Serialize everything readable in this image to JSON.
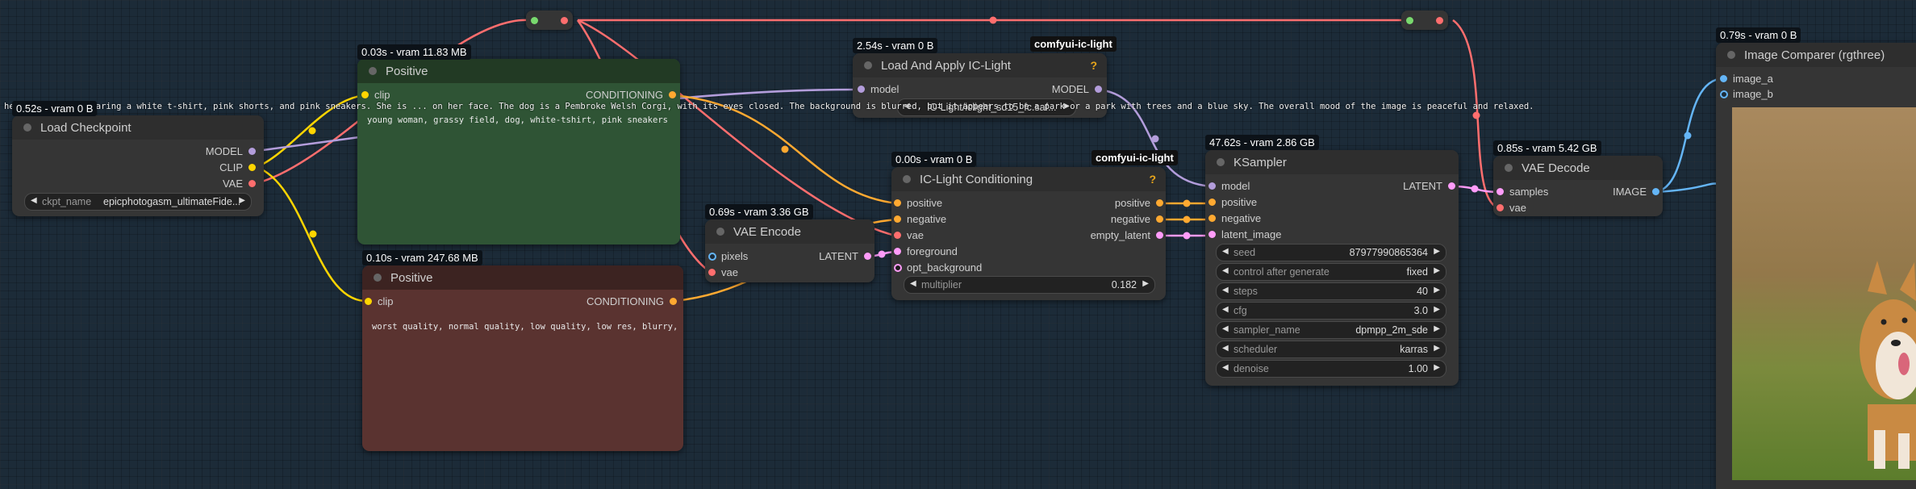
{
  "canvas": {
    "overlay_text": "her (Ok 0-s) is wearing a white t-shirt, pink shorts, and pink sneakers. She is ... on her face. The dog is a Pembroke Welsh Corgi, with its eyes closed. The background is blurred, but it appears to be a park or a park with trees and a blue sky. The overall mood of the image is peaceful and relaxed."
  },
  "colors": {
    "model": "#b39ddb",
    "clip": "#ffd500",
    "vae": "#ff6e6e",
    "conditioning": "#ffa931",
    "latent": "#ff9cf9",
    "image": "#64b5f6",
    "positive_node": "#2f5435",
    "negative_node": "#5a3330",
    "accent_warning": "#e8a61b"
  },
  "nodes": {
    "load_checkpoint": {
      "timing": "0.52s - vram 0 B",
      "title": "Load Checkpoint",
      "outputs": [
        "MODEL",
        "CLIP",
        "VAE"
      ],
      "widget": {
        "name": "ckpt_name",
        "value": "epicphotogasm_ultimateFide..."
      }
    },
    "positive": {
      "timing": "0.03s - vram 11.83 MB",
      "title": "Positive",
      "input": "clip",
      "output": "CONDITIONING",
      "text": "young woman, grassy field, dog, white-tshirt, pink sneakers"
    },
    "negative": {
      "timing": "0.10s - vram 247.68 MB",
      "title": "Positive",
      "input": "clip",
      "output": "CONDITIONING",
      "text": "worst quality, normal quality, low quality, low res, blurry, text, watermark, logo, banner, extra digits, cropped, jpeg artifacts, signature, username, error, sketch, duplicate, ugly, monochrome"
    },
    "load_apply_ic_light": {
      "timing": "2.54s - vram 0 B",
      "badge": "comfyui-ic-light",
      "warning": "?",
      "title": "Load And Apply IC-Light",
      "input": "model",
      "output": "MODEL",
      "widget": {
        "name": "model_path",
        "value": "IC-Light/iclight_sd15_fc.saf..."
      }
    },
    "ic_light_conditioning": {
      "timing": "0.00s - vram 0 B",
      "badge": "comfyui-ic-light",
      "warning": "?",
      "title": "IC-Light Conditioning",
      "inputs": [
        "positive",
        "negative",
        "vae",
        "foreground",
        "opt_background"
      ],
      "outputs": [
        "positive",
        "negative",
        "empty_latent"
      ],
      "widget": {
        "name": "multiplier",
        "value": "0.182"
      }
    },
    "vae_encode": {
      "timing": "0.69s - vram 3.36 GB",
      "title": "VAE Encode",
      "inputs": [
        "pixels",
        "vae"
      ],
      "output": "LATENT"
    },
    "ksampler": {
      "timing": "47.62s - vram 2.86 GB",
      "title": "KSampler",
      "inputs": [
        "model",
        "positive",
        "negative",
        "latent_image"
      ],
      "output": "LATENT",
      "widgets": [
        {
          "name": "seed",
          "value": "87977990865364"
        },
        {
          "name": "control after generate",
          "value": "fixed"
        },
        {
          "name": "steps",
          "value": "40"
        },
        {
          "name": "cfg",
          "value": "3.0"
        },
        {
          "name": "sampler_name",
          "value": "dpmpp_2m_sde"
        },
        {
          "name": "scheduler",
          "value": "karras"
        },
        {
          "name": "denoise",
          "value": "1.00"
        }
      ]
    },
    "vae_decode": {
      "timing": "0.85s - vram 5.42 GB",
      "title": "VAE Decode",
      "inputs": [
        "samples",
        "vae"
      ],
      "output": "IMAGE"
    },
    "image_comparer": {
      "timing": "0.79s - vram 0 B",
      "title": "Image Comparer (rgthree)",
      "inputs": [
        "image_a",
        "image_b"
      ]
    }
  }
}
